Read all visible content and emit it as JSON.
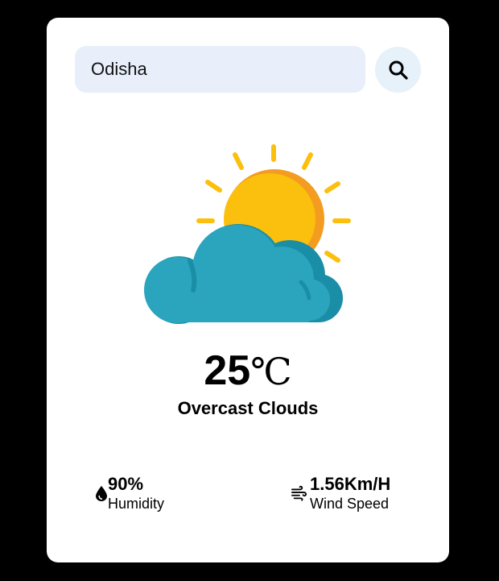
{
  "search": {
    "value": "Odisha",
    "button_icon": "search-icon"
  },
  "weather": {
    "icon": "sun-behind-cloud-icon",
    "temperature": "25",
    "unit": "℃",
    "condition": "Overcast Clouds"
  },
  "details": {
    "humidity": {
      "icon": "water-drop-icon",
      "value": "90%",
      "label": "Humidity"
    },
    "wind": {
      "icon": "wind-icon",
      "value": "1.56Km/H",
      "label": "Wind Speed"
    }
  },
  "colors": {
    "background": "#000000",
    "card": "#ffffff",
    "search_field": "#e8effb",
    "search_button": "#e6f1fa",
    "sun": "#fbbf0e",
    "sun_shade": "#f39c1f",
    "cloud": "#2aa5bd",
    "cloud_shade": "#1a8ea6"
  }
}
